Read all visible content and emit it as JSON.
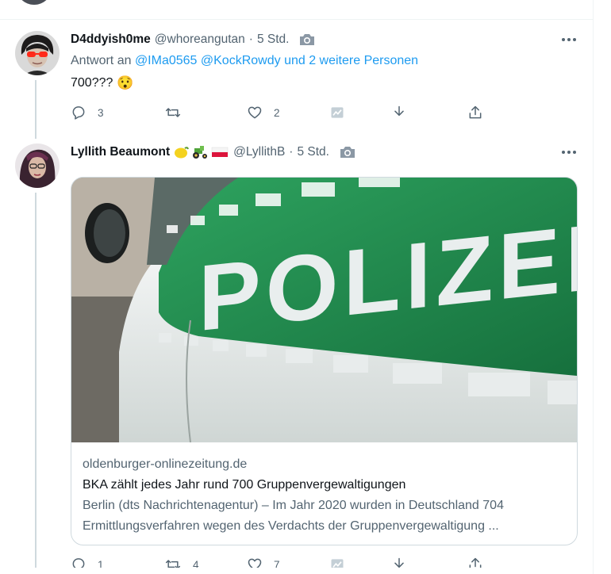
{
  "tweets": [
    {
      "display_name": "D4ddyish0me",
      "handle": "@whoreangutan",
      "dot": "·",
      "time": "5 Std.",
      "reply_prefix": "Antwort an",
      "reply_mentions": "@IMa0565 @KockRowdy",
      "reply_more": "und 2 weitere Personen",
      "text": "700???",
      "emoji": "😯",
      "reply_count": "3",
      "retweet_count": "",
      "like_count": "2"
    },
    {
      "display_name": "Lyllith Beaumont",
      "handle": "@LyllithB",
      "dot": "·",
      "time": "5 Std.",
      "card": {
        "image_text": "POLIZEI",
        "domain": "oldenburger-onlinezeitung.de",
        "title": "BKA zählt jedes Jahr rund 700 Gruppenvergewaltigungen",
        "description_line1": "Berlin (dts Nachrichtenagentur) – Im Jahr 2020 wurden in Deutschland 704",
        "description_line2": "Ermittlungsverfahren wegen des Verdachts der Gruppenvergewaltigung ..."
      },
      "reply_count": "1",
      "retweet_count": "4",
      "like_count": "7"
    }
  ],
  "colors": {
    "accent": "#1d9bf0",
    "text_primary": "#0f1419",
    "text_secondary": "#536471",
    "border": "#eff3f4",
    "police_green": "#1f8a4c"
  }
}
